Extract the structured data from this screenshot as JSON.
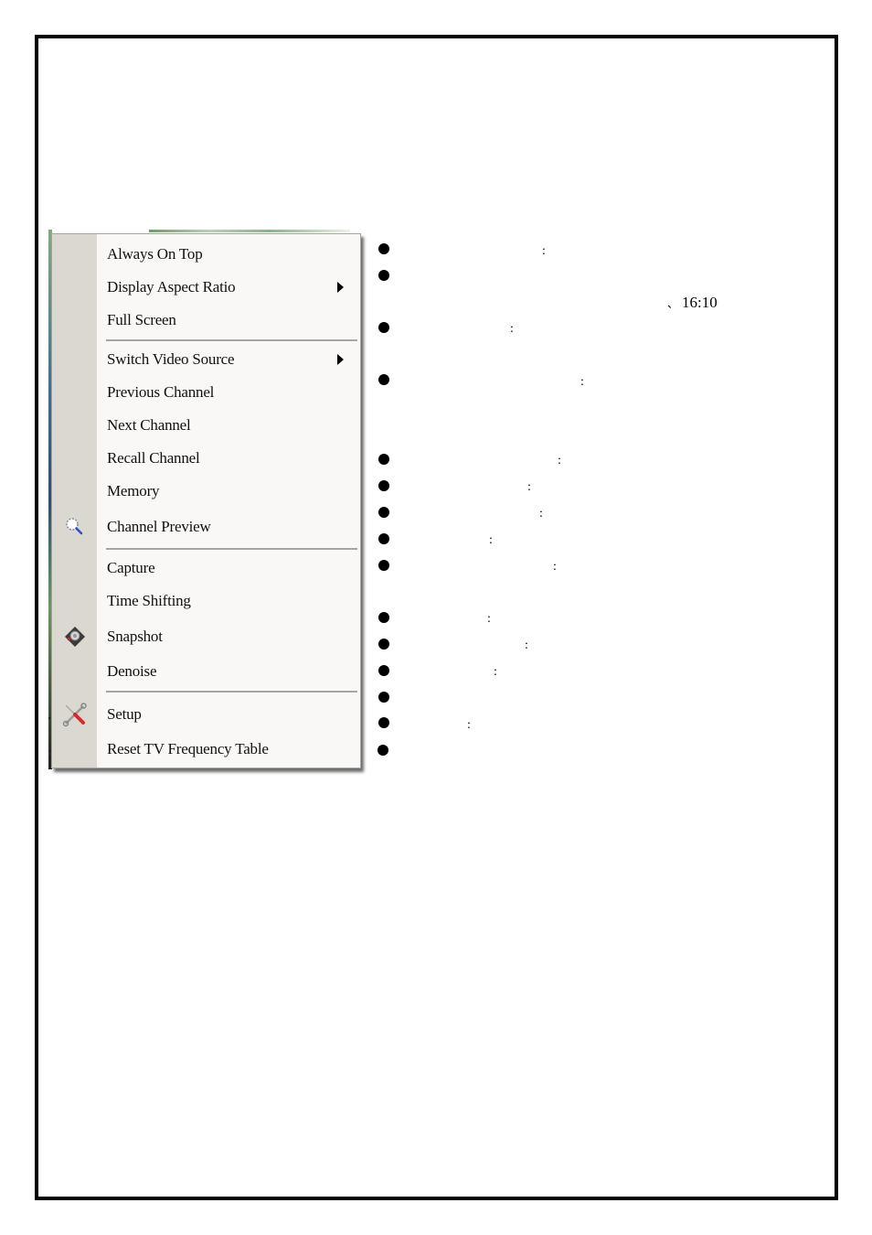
{
  "context_menu": {
    "items": [
      {
        "label": "Always On Top",
        "submenu": false,
        "icon": null
      },
      {
        "label": "Display Aspect Ratio",
        "submenu": true,
        "icon": null
      },
      {
        "label": "Full Screen",
        "submenu": false,
        "icon": null
      },
      {
        "label": "Switch Video Source",
        "submenu": true,
        "icon": null
      },
      {
        "label": "Previous Channel",
        "submenu": false,
        "icon": null
      },
      {
        "label": "Next Channel",
        "submenu": false,
        "icon": null
      },
      {
        "label": "Recall Channel",
        "submenu": false,
        "icon": null
      },
      {
        "label": "Memory",
        "submenu": false,
        "icon": null
      },
      {
        "label": "Channel Preview",
        "submenu": false,
        "icon": "magnifier-icon"
      },
      {
        "label": "Capture",
        "submenu": false,
        "icon": null
      },
      {
        "label": "Time Shifting",
        "submenu": false,
        "icon": null
      },
      {
        "label": "Snapshot",
        "submenu": false,
        "icon": "camera-icon"
      },
      {
        "label": "Denoise",
        "submenu": false,
        "icon": null
      },
      {
        "label": "Setup",
        "submenu": false,
        "icon": "tools-icon"
      },
      {
        "label": "Reset TV Frequency Table",
        "submenu": false,
        "icon": null
      }
    ],
    "separators_after": [
      "Full Screen",
      "Channel Preview",
      "Denoise"
    ]
  },
  "descriptions": {
    "bullet_symbol": "●",
    "colon": ":",
    "aspect_ratio_note": "16:10",
    "aspect_ratio_mark": "、"
  },
  "colors": {
    "menu_bg": "#f9f8f6",
    "gutter_bg": "#dad8d1",
    "separator": "#a8a6a0",
    "page_border": "#000000"
  }
}
